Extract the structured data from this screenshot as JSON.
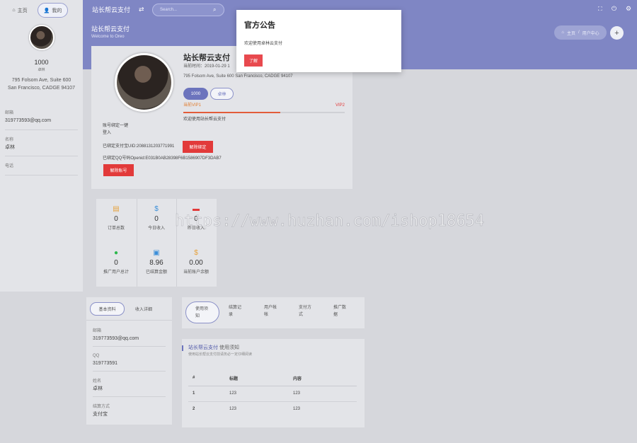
{
  "sidebar": {
    "tabs": [
      {
        "label": "主页",
        "icon": "home-icon"
      },
      {
        "label": "我的",
        "icon": "user-icon"
      }
    ],
    "count": "1000",
    "badge": "卓林",
    "address_line1": "795 Folsom Ave, Suite 600",
    "address_line2": "San Francisco, CADGE 94107",
    "fields": [
      {
        "label": "邮箱",
        "value": "319773593@qq.com"
      },
      {
        "label": "名称",
        "value": "卓林"
      },
      {
        "label": "电话",
        "value": ""
      }
    ]
  },
  "topbar": {
    "brand": "站长帮云支付",
    "toggle_icon": "swap-icon",
    "search_placeholder": "Search...",
    "right_icons": [
      "fullscreen-icon",
      "power-icon",
      "gear-icon"
    ]
  },
  "hero": {
    "title": "站长帮云支付",
    "subtitle": "Welcome to Oreo",
    "breadcrumb_home": "主页",
    "breadcrumb_sep": "/",
    "breadcrumb_current": "用户中心",
    "plus_label": "+"
  },
  "profile": {
    "name": "站长帮云支付",
    "time": "当前时间：2019-01-29 1",
    "address": "795 Folsom Ave, Suite 600 San Francisco, CADGE 94107",
    "btn_count": "1000",
    "btn_second": "卓林",
    "level_left": "当前VIP1",
    "level_right": "VIP2",
    "level_progress": 0.6,
    "welcome": "欢迎使用站长帮云支付",
    "bind_title": "账号绑定一键",
    "bind_sub": "登入",
    "alipay_text": "已绑定支付宝UID:2088131203771991",
    "alipay_btn": "解除绑定",
    "qq_text": "已绑定QQ号码Openid:E031B0AB28398F6B1586907DF3DAB7",
    "qq_btn": "解除账号"
  },
  "stats": [
    {
      "icon": "clipboard-icon",
      "color": "#e6a23c",
      "value": "0",
      "label": "订单总数"
    },
    {
      "icon": "dollar-icon",
      "color": "#3b8fd9",
      "value": "0",
      "label": "今日收入"
    },
    {
      "icon": "message-icon",
      "color": "#e23a3a",
      "value": "0",
      "label": "昨日收入"
    },
    {
      "icon": "user-icon",
      "color": "#2db84d",
      "value": "0",
      "label": "推广用户总计"
    },
    {
      "icon": "document-icon",
      "color": "#3b8fd9",
      "value": "8.96",
      "label": "已结算金额"
    },
    {
      "icon": "dollar-icon",
      "color": "#e6a23c",
      "value": "0.00",
      "label": "当前账户余额"
    }
  ],
  "info_card": {
    "tabs": [
      "基本资料",
      "收入详细"
    ],
    "fields": [
      {
        "label": "邮箱",
        "value": "319773593@qq.com"
      },
      {
        "label": "QQ",
        "value": "319773591"
      },
      {
        "label": "姓名",
        "value": "卓林"
      },
      {
        "label": "结算方式",
        "value": "支付宝"
      }
    ]
  },
  "right_tabs": [
    {
      "l1": "使用须",
      "l2": "知"
    },
    {
      "l1": "结算记",
      "l2": "录"
    },
    {
      "l1": "用户帐",
      "l2": "帐"
    },
    {
      "l1": "支付方",
      "l2": "式"
    },
    {
      "l1": "推广数",
      "l2": "据"
    }
  ],
  "notice": {
    "title_brand": "站长帮云支付",
    "title_suffix": "使用须知",
    "desc": "使用站长帮云支付前请务必一定仔细阅读",
    "columns": [
      "#",
      "标题",
      "内容"
    ],
    "rows": [
      [
        "1",
        "123",
        "123"
      ],
      [
        "2",
        "123",
        "123"
      ]
    ]
  },
  "modal": {
    "title": "官方公告",
    "body": "欢迎使用卓林云支付",
    "button": "了解"
  },
  "watermark": "https://www.huzhan.com/ishop18654"
}
